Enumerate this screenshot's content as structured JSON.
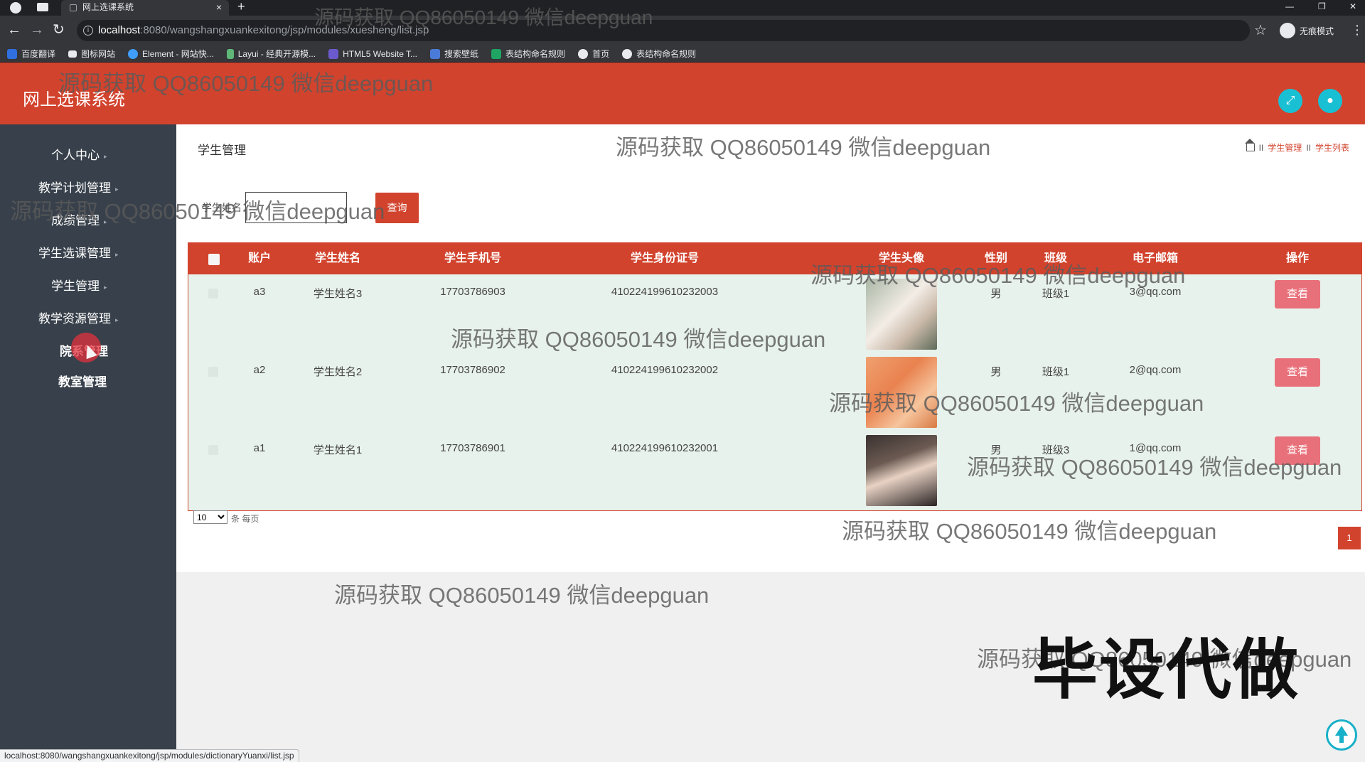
{
  "browser": {
    "tab_title": "网上选课系统",
    "tab_close": "×",
    "new_tab": "+",
    "url_host": "localhost",
    "url_path": ":8080/wangshangxuankexitong/jsp/modules/xuesheng/list.jsp",
    "incognito_label": "无痕模式",
    "bookmarks": [
      "百度翻译",
      "图标网站",
      "Element - 网站快...",
      "Layui - 经典开源模...",
      "HTML5 Website T...",
      "搜索壁纸",
      "表结构命名规则",
      "首页",
      "表结构命名规则"
    ],
    "status_url": "localhost:8080/wangshangxuankexitong/jsp/modules/dictionaryYuanxi/list.jsp"
  },
  "app": {
    "title": "网上选课系统",
    "accent_color": "#d2432d"
  },
  "sidebar": {
    "items": [
      {
        "label": "个人中心"
      },
      {
        "label": "教学计划管理"
      },
      {
        "label": "成绩管理"
      },
      {
        "label": "学生选课管理"
      },
      {
        "label": "学生管理"
      },
      {
        "label": "教学资源管理"
      },
      {
        "label": "院系管理"
      },
      {
        "label": "教室管理"
      }
    ]
  },
  "page": {
    "title": "学生管理",
    "breadcrumb": [
      "学生管理",
      "学生列表"
    ],
    "breadcrumb_sep": "II",
    "search_label": "学生姓名",
    "search_button": "查询"
  },
  "table": {
    "columns": [
      "账户",
      "学生姓名",
      "学生手机号",
      "学生身份证号",
      "学生头像",
      "性别",
      "班级",
      "电子邮箱",
      "操作"
    ],
    "rows": [
      {
        "account": "a3",
        "name": "学生姓名3",
        "phone": "17703786903",
        "id_card": "410224199610232003",
        "gender": "男",
        "class": "班级1",
        "email": "3@qq.com",
        "action": "查看"
      },
      {
        "account": "a2",
        "name": "学生姓名2",
        "phone": "17703786902",
        "id_card": "410224199610232002",
        "gender": "男",
        "class": "班级1",
        "email": "2@qq.com",
        "action": "查看"
      },
      {
        "account": "a1",
        "name": "学生姓名1",
        "phone": "17703786901",
        "id_card": "410224199610232001",
        "gender": "男",
        "class": "班级3",
        "email": "1@qq.com",
        "action": "查看"
      }
    ]
  },
  "pager": {
    "page_size": "10",
    "page_size_suffix": "条 每页",
    "current_page": "1"
  },
  "watermark": "源码获取 QQ86050149 微信deepguan",
  "promo_text": "毕设代做"
}
